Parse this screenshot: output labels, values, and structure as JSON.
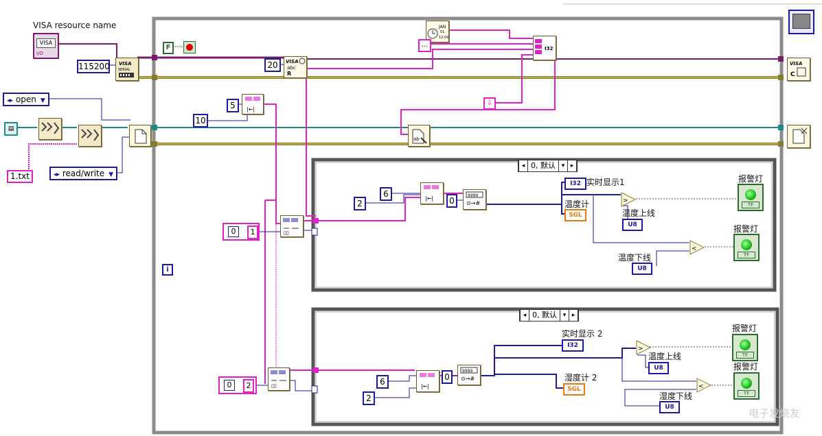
{
  "labels": {
    "visa_resource_name": "VISA resource name",
    "realtime1": "实时显示1",
    "temperature_meter": "温度计",
    "temp_upper": "温度上线",
    "temp_lower": "温度下线",
    "alarm1": "报警灯",
    "alarm2": "报警灯",
    "realtime2": "实时显示 2",
    "humidity_meter2": "湿度计 2",
    "hum_upper": "温度上线",
    "hum_lower": "湿度下线",
    "alarm3": "报警灯",
    "alarm4": "报警灯",
    "watermark": "电子发烧友"
  },
  "constants": {
    "baud": "115200",
    "bytes": "20",
    "c5": "5",
    "c10": "10",
    "c2a": "2",
    "c6a": "6",
    "c0a": "0",
    "c2b": "6",
    "c6b": "2",
    "c0b": "0",
    "idx1": "0",
    "idx1_val": "1",
    "idx2": "0",
    "idx2_val": "2",
    "false_const": "F",
    "iter": "i",
    "filename": "1.txt",
    "empty_str": "...",
    "visa": "VISA"
  },
  "rings": {
    "open": "open",
    "readwrite": "read/write"
  },
  "case1": {
    "selector": "0, 默认"
  },
  "case2": {
    "selector": "0, 默认"
  },
  "types": {
    "i32a": "I32",
    "sgla": "SGL",
    "u8a": "U8",
    "u8b": "U8",
    "i32b": "I32",
    "sglb": "SGL",
    "u8c": "U8",
    "u8d": "U8"
  },
  "indicator_text": {
    "tf": "TF"
  },
  "colors": {
    "wire_pink": "#e020c8",
    "wire_blue": "#1a1a9e",
    "wire_teal": "#1a8a8a",
    "error_yellow": "#8a7a2a",
    "frame_gray": "#8c8c8c",
    "alarm_green": "#1ec21e"
  }
}
